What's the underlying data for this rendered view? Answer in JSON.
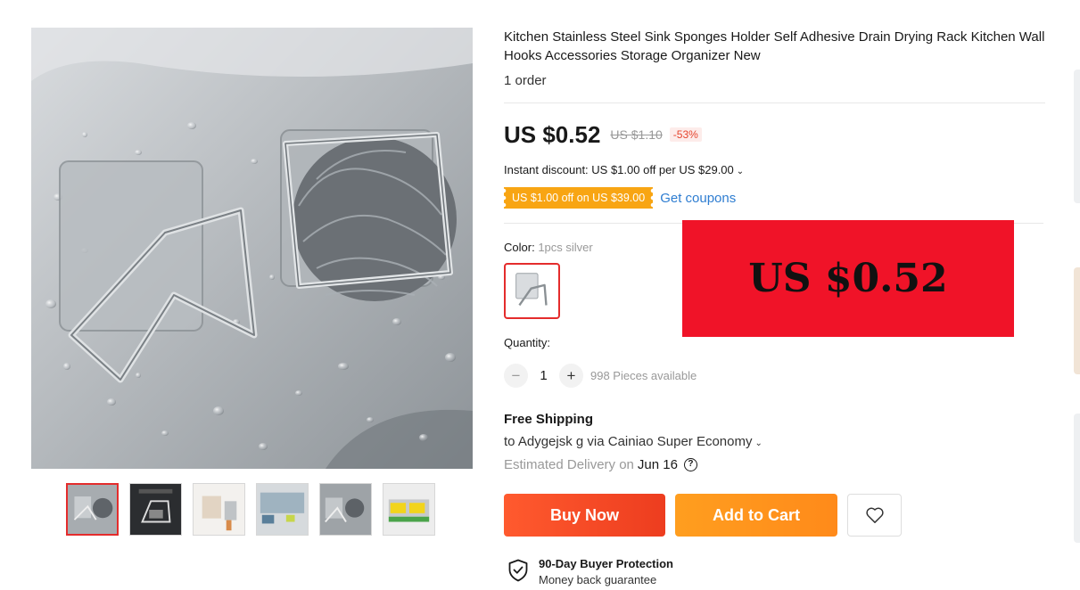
{
  "product": {
    "title": "Kitchen Stainless Steel Sink Sponges Holder Self Adhesive Drain Drying Rack Kitchen Wall Hooks Accessories Storage Organizer New",
    "orders": "1 order"
  },
  "price": {
    "current": "US $0.52",
    "original": "US $1.10",
    "discount": "-53%"
  },
  "discounts": {
    "instant": "Instant discount: US $1.00 off per US $29.00",
    "coupon": "US $1.00 off on US $39.00",
    "get_coupons": "Get coupons"
  },
  "promo_overlay": {
    "text": "US $0.52",
    "background": "#f01328"
  },
  "color": {
    "label": "Color:",
    "selected": "1pcs silver"
  },
  "quantity": {
    "label": "Quantity:",
    "minus": "−",
    "value": "1",
    "plus": "+",
    "available": "998 Pieces available"
  },
  "shipping": {
    "title": "Free Shipping",
    "destination": "to Adygejsk g via Cainiao Super Economy",
    "estimated_label": "Estimated Delivery on",
    "estimated_date": "Jun 16"
  },
  "actions": {
    "buy_now": "Buy Now",
    "add_to_cart": "Add to Cart"
  },
  "protection": {
    "title": "90-Day Buyer Protection",
    "subtitle": "Money back guarantee"
  },
  "colors": {
    "accent_red": "#e42c2c",
    "buy_now": "#ff5a2e",
    "add_to_cart": "#ff9e1f",
    "coupon_tag": "#f8a513",
    "link": "#2e7dd1"
  },
  "icons": {
    "wishlist": "heart-icon",
    "help": "question-circle-icon",
    "protection": "shield-check-icon",
    "dropdown": "chevron-down-icon"
  }
}
